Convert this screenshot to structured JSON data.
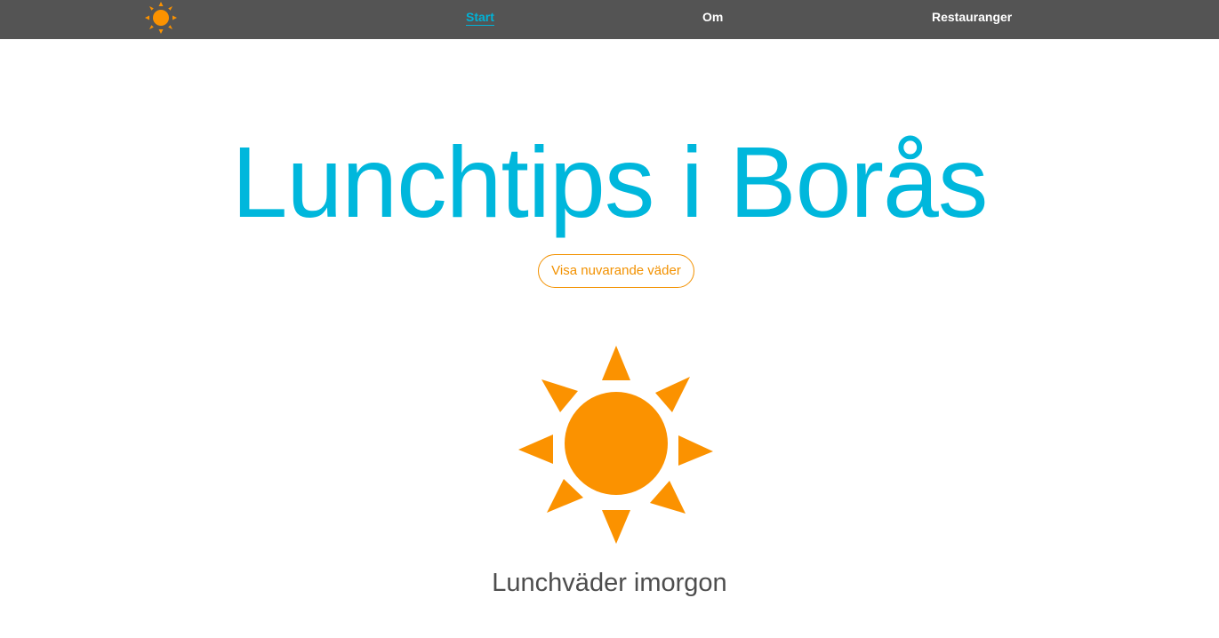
{
  "nav": {
    "logo_icon": "sun-icon",
    "links": [
      {
        "label": "Start",
        "active": true
      },
      {
        "label": "Om",
        "active": false
      },
      {
        "label": "Restauranger",
        "active": false
      }
    ]
  },
  "hero": {
    "title": "Lunchtips i Borås",
    "button_label": "Visa nuvarande väder"
  },
  "weather": {
    "icon": "sun-icon",
    "label": "Lunchväder imorgon"
  },
  "colors": {
    "nav_background": "#545454",
    "accent_blue": "#00b7dc",
    "sun_orange": "#fb9200",
    "button_orange": "#f29100",
    "text_gray": "#4d4d4d"
  }
}
